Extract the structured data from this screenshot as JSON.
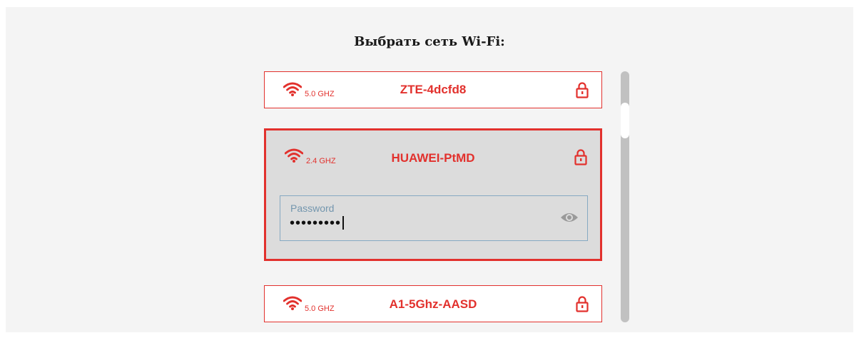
{
  "title": "Выбрать сеть Wi-Fi:",
  "networks": [
    {
      "ssid": "ZTE-4dcfd8",
      "band": "5.0 GHZ",
      "locked": true,
      "selected": false
    },
    {
      "ssid": "HUAWEI-PtMD",
      "band": "2.4 GHZ",
      "locked": true,
      "selected": true
    },
    {
      "ssid": "A1-5Ghz-AASD",
      "band": "5.0 GHZ",
      "locked": true,
      "selected": false
    }
  ],
  "password": {
    "label": "Password",
    "value": "•••••••••"
  },
  "colors": {
    "accent": "#e2312d",
    "selected_background": "#dcdcdc",
    "field_border": "#86a9c2",
    "scrollbar_track": "#c1c1c1"
  },
  "icons": {
    "signal": "wifi-icon",
    "security": "lock-icon",
    "reveal": "eye-icon"
  }
}
